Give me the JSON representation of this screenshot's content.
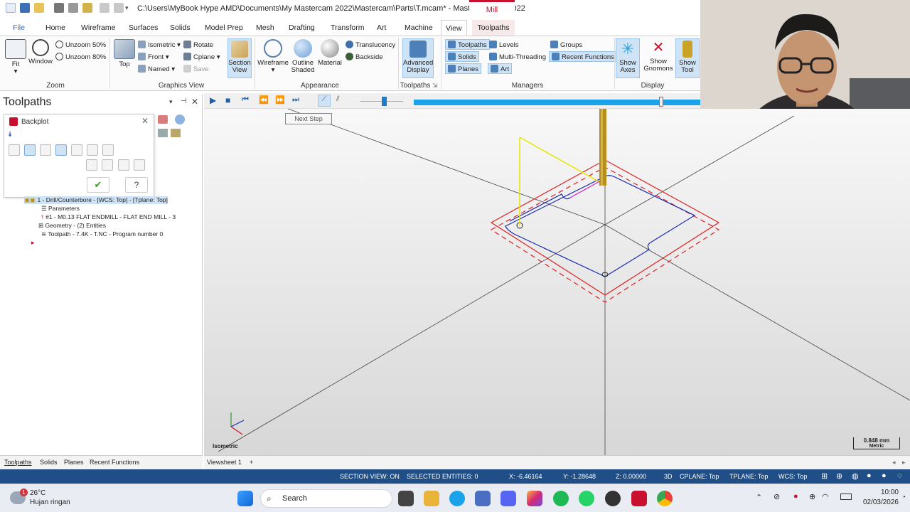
{
  "window": {
    "title": "C:\\Users\\MyBook Hype AMD\\Documents\\My Mastercam 2022\\Mastercam\\Parts\\T.mcam* - Mastercam Mill 2022",
    "context_tab": "Mill"
  },
  "tabs": [
    "File",
    "Home",
    "Wireframe",
    "Surfaces",
    "Solids",
    "Model Prep",
    "Mesh",
    "Drafting",
    "Transform",
    "Art",
    "Machine",
    "View",
    "Toolpaths"
  ],
  "ribbon": {
    "zoom": {
      "fit": "Fit",
      "window": "Window",
      "unzoom50": "Unzoom 50%",
      "unzoom80": "Unzoom 80%",
      "label": "Zoom"
    },
    "graphics_view": {
      "top": "Top",
      "isometric": "Isometric",
      "front": "Front",
      "named": "Named",
      "rotate": "Rotate",
      "cplane": "Cplane",
      "save": "Save",
      "section_view": "Section View",
      "label": "Graphics View"
    },
    "appearance": {
      "wireframe": "Wireframe",
      "outline_shaded": "Outline Shaded",
      "material": "Material",
      "translucency": "Translucency",
      "backside": "Backside",
      "label": "Appearance"
    },
    "toolpaths_grp": {
      "advanced_display": "Advanced Display",
      "label": "Toolpaths"
    },
    "managers": {
      "toolpaths": "Toolpaths",
      "solids": "Solids",
      "planes": "Planes",
      "levels": "Levels",
      "multi_threading": "Multi-Threading",
      "art": "Art",
      "groups": "Groups",
      "recent_functions": "Recent Functions",
      "label": "Managers"
    },
    "display": {
      "show_axes": "Show Axes",
      "show_gnomons": "Show Gnomons",
      "show_tool": "Show Tool",
      "label": "Display"
    }
  },
  "left_panel": {
    "title": "Toolpaths",
    "backplot": {
      "title": "Backplot"
    },
    "tree": [
      "1 - Drill/Counterbore - [WCS: Top] - [Tplane: Top]",
      "Parameters",
      "#1 - M0.13 FLAT ENDMILL - FLAT END MILL - 3",
      "Geometry - (2) Entities",
      "Toolpath - 7.4K - T.NC - Program number 0"
    ]
  },
  "viewport": {
    "tooltip": "Next Step",
    "view_label": "Isometric",
    "scale_value": "0.848 mm",
    "scale_unit": "Metric"
  },
  "bottom_tabs": [
    "Toolpaths",
    "Solids",
    "Planes",
    "Recent Functions"
  ],
  "sheet_tab": "Viewsheet 1",
  "sheet_add": "+",
  "status": {
    "section_view": "SECTION VIEW: ON",
    "selected": "SELECTED ENTITIES: 0",
    "x": "X:   -6.46164",
    "y": "Y:   -1.28648",
    "z": "Z:  0.00000",
    "mode": "3D",
    "cplane": "CPLANE: Top",
    "tplane": "TPLANE: Top",
    "wcs": "WCS: Top"
  },
  "taskbar": {
    "weather_temp": "26°C",
    "weather_desc": "Hujan ringan",
    "search": "Search",
    "time": "10:00",
    "date": "02/03/2026"
  },
  "colors": {
    "accent": "#c8102e",
    "status_bar": "#1f4f86",
    "progress": "#1aa3e8"
  }
}
